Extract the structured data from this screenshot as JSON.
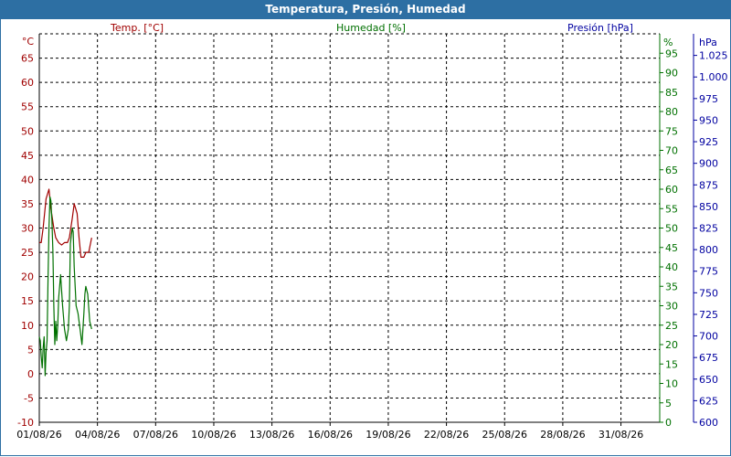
{
  "window": {
    "title": "Temperatura, Presión, Humedad"
  },
  "chart_data": {
    "type": "line",
    "x_tick_labels": [
      "01/08/26",
      "04/08/26",
      "07/08/26",
      "10/08/26",
      "13/08/26",
      "16/08/26",
      "19/08/26",
      "22/08/26",
      "25/08/26",
      "28/08/26",
      "31/08/26"
    ],
    "x_range_days": [
      1,
      33
    ],
    "axes": {
      "temperature": {
        "unit": "°C",
        "ylim": [
          -10,
          70
        ],
        "ticks": [
          -10,
          -5,
          0,
          5,
          10,
          15,
          20,
          25,
          30,
          35,
          40,
          45,
          50,
          55,
          60,
          65
        ],
        "color": "#a00000"
      },
      "humidity": {
        "unit": "%",
        "ylim": [
          0,
          100
        ],
        "ticks": [
          0,
          5,
          10,
          15,
          20,
          25,
          30,
          35,
          40,
          45,
          50,
          55,
          60,
          65,
          70,
          75,
          80,
          85,
          90,
          95
        ],
        "color": "#007000"
      },
      "pressure": {
        "unit": "hPa",
        "ylim": [
          600,
          1050
        ],
        "ticks": [
          "600",
          "625",
          "650",
          "675",
          "700",
          "725",
          "750",
          "775",
          "800",
          "825",
          "850",
          "875",
          "900",
          "925",
          "950",
          "975",
          "1.000",
          "1.025"
        ],
        "tick_values": [
          600,
          625,
          650,
          675,
          700,
          725,
          750,
          775,
          800,
          825,
          850,
          875,
          900,
          925,
          950,
          975,
          1000,
          1025
        ],
        "color": "#0000a0"
      }
    },
    "series": [
      {
        "name": "Temp. [°C]",
        "axis": "temperature",
        "color": "#a00000",
        "x": [
          1.0,
          1.1,
          1.2,
          1.35,
          1.5,
          1.6,
          1.75,
          1.85,
          2.0,
          2.15,
          2.3,
          2.45,
          2.55,
          2.7,
          2.8,
          2.95,
          3.05,
          3.15,
          3.3,
          3.4,
          3.55,
          3.7
        ],
        "y": [
          27,
          27,
          30,
          36,
          38,
          34,
          30,
          28,
          27,
          26.5,
          27,
          27,
          28,
          32,
          35,
          33,
          28,
          24,
          24,
          25,
          25,
          28
        ]
      },
      {
        "name": "Humedad [%]",
        "axis": "humidity",
        "color": "#007000",
        "x": [
          1.0,
          1.05,
          1.1,
          1.15,
          1.2,
          1.25,
          1.3,
          1.35,
          1.4,
          1.45,
          1.5,
          1.55,
          1.6,
          1.65,
          1.7,
          1.75,
          1.8,
          1.85,
          1.9,
          1.95,
          2.0,
          2.1,
          2.2,
          2.3,
          2.4,
          2.5,
          2.55,
          2.6,
          2.7,
          2.75,
          2.8,
          2.9,
          3.0,
          3.1,
          3.2,
          3.3,
          3.35,
          3.4,
          3.5,
          3.6,
          3.7
        ],
        "y": [
          22,
          21,
          17,
          14,
          19,
          22,
          12,
          18,
          21,
          36,
          50,
          58,
          57,
          52,
          44,
          30,
          20,
          26,
          21,
          25,
          32,
          38,
          30,
          24,
          21,
          24,
          30,
          46,
          50,
          49,
          40,
          30,
          28,
          24,
          20,
          28,
          33,
          35,
          33,
          26,
          24
        ]
      }
    ]
  }
}
